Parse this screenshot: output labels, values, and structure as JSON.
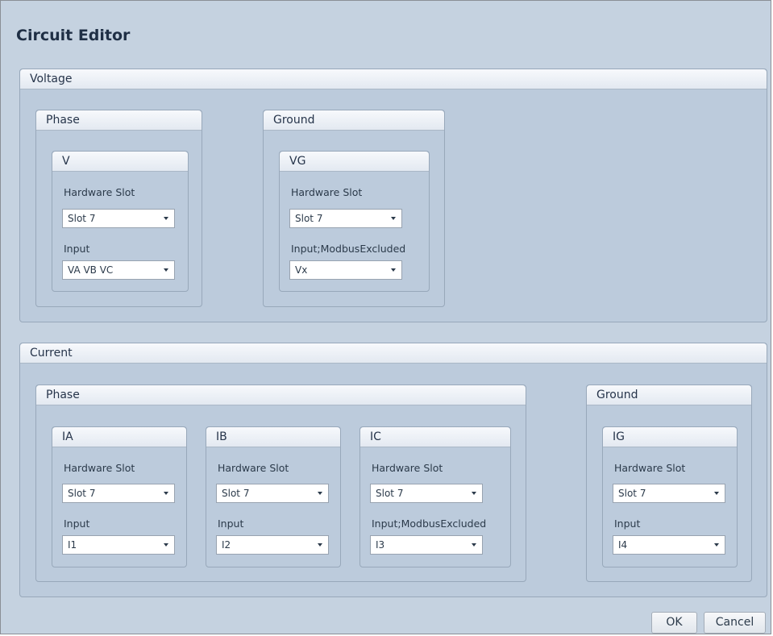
{
  "window": {
    "title": "Circuit Editor"
  },
  "voltage": {
    "title": "Voltage",
    "phase": {
      "title": "Phase",
      "v": {
        "title": "V",
        "slot_label": "Hardware Slot",
        "slot_value": "Slot 7",
        "input_label": "Input",
        "input_value": "VA VB VC"
      }
    },
    "ground": {
      "title": "Ground",
      "vg": {
        "title": "VG",
        "slot_label": "Hardware Slot",
        "slot_value": "Slot 7",
        "input_label": "Input;ModbusExcluded",
        "input_value": "Vx"
      }
    }
  },
  "current": {
    "title": "Current",
    "phase": {
      "title": "Phase",
      "ia": {
        "title": "IA",
        "slot_label": "Hardware Slot",
        "slot_value": "Slot 7",
        "input_label": "Input",
        "input_value": "I1"
      },
      "ib": {
        "title": "IB",
        "slot_label": "Hardware Slot",
        "slot_value": "Slot 7",
        "input_label": "Input",
        "input_value": "I2"
      },
      "ic": {
        "title": "IC",
        "slot_label": "Hardware Slot",
        "slot_value": "Slot 7",
        "input_label": "Input;ModbusExcluded",
        "input_value": "I3"
      }
    },
    "ground": {
      "title": "Ground",
      "ig": {
        "title": "IG",
        "slot_label": "Hardware Slot",
        "slot_value": "Slot 7",
        "input_label": "Input",
        "input_value": "I4"
      }
    }
  },
  "buttons": {
    "ok": "OK",
    "cancel": "Cancel"
  }
}
